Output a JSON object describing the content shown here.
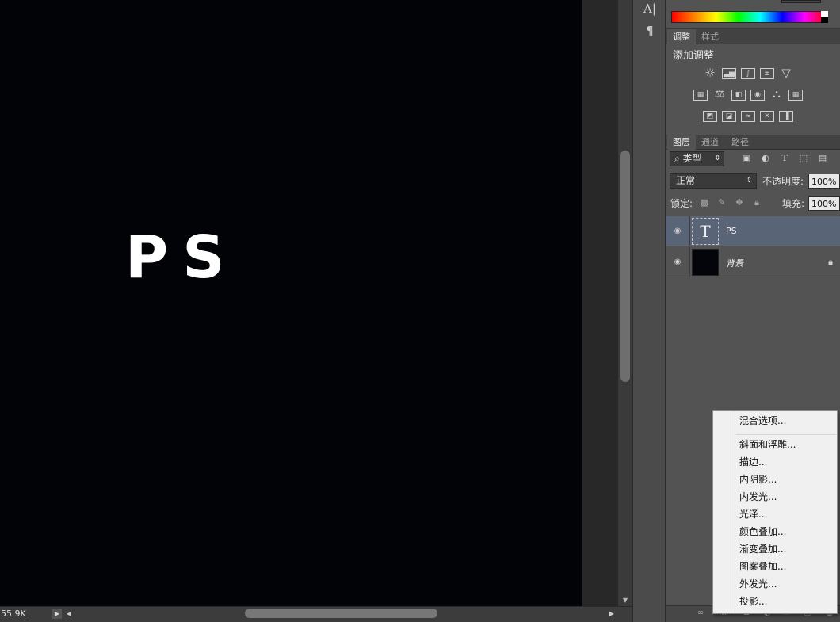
{
  "canvas": {
    "text": "PS"
  },
  "status": {
    "doc_size": "55.9K"
  },
  "tools": {
    "character_icon": "A|",
    "paragraph_icon": "¶"
  },
  "adjustments": {
    "tabs": [
      "调整",
      "样式"
    ],
    "title": "添加调整",
    "icons": [
      "brightness-contrast-icon",
      "levels-icon",
      "curves-icon",
      "exposure-icon",
      "vibrance-icon",
      "hue-saturation-icon",
      "color-balance-icon",
      "black-white-icon",
      "photo-filter-icon",
      "channel-mixer-icon",
      "color-lookup-icon",
      "invert-icon",
      "posterize-icon",
      "threshold-icon",
      "selective-color-icon",
      "gradient-map-icon"
    ]
  },
  "layers": {
    "tabs": [
      "图层",
      "通道",
      "路径"
    ],
    "filter_value": "类型",
    "blend_mode": "正常",
    "opacity_label": "不透明度:",
    "opacity_value": "100%",
    "lock_label": "锁定:",
    "fill_label": "填充:",
    "fill_value": "100%",
    "items": [
      {
        "name": "PS",
        "type": "text",
        "selected": true
      },
      {
        "name": "背景",
        "type": "background",
        "locked": true
      }
    ]
  },
  "context_menu": {
    "items": [
      "混合选项...",
      "斜面和浮雕...",
      "描边...",
      "内阴影...",
      "内发光...",
      "光泽...",
      "颜色叠加...",
      "渐变叠加...",
      "图案叠加...",
      "外发光...",
      "投影..."
    ]
  },
  "colors": {
    "selected_layer": "#5a6477",
    "panel": "#535353",
    "canvas": "#020307"
  }
}
